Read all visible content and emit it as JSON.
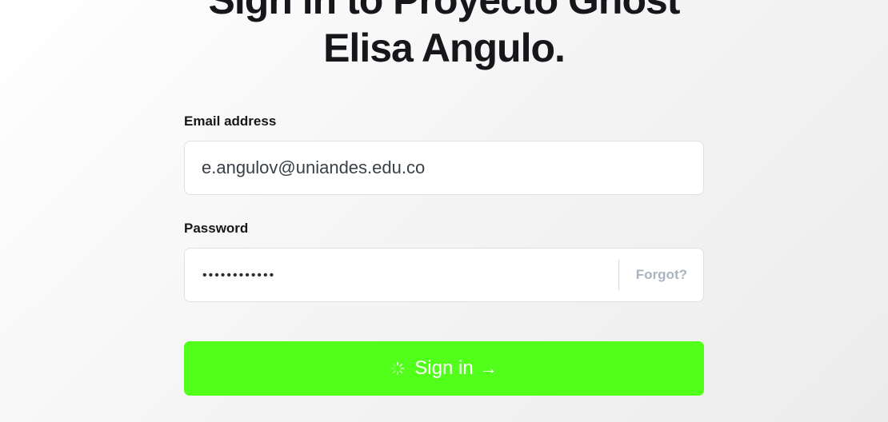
{
  "heading": {
    "line1": "Sign in to Proyecto Ghost",
    "line2": "Elisa Angulo."
  },
  "form": {
    "email_label": "Email address",
    "email_value": "e.angulov@uniandes.edu.co",
    "password_label": "Password",
    "password_mask": "••••••••••••",
    "forgot_label": "Forgot?",
    "submit_label": "Sign in",
    "submit_arrow": "→",
    "submit_state": "loading"
  },
  "colors": {
    "accent": "#52ff1a",
    "text": "#15171a",
    "muted": "#abb4be",
    "border": "#dde1e5"
  }
}
